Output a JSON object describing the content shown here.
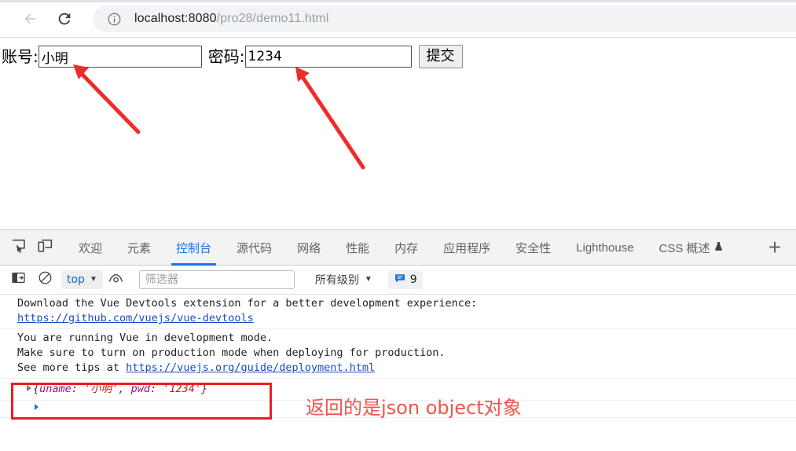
{
  "browser": {
    "back_tooltip": "Back",
    "reload_tooltip": "Reload",
    "url_host": "localhost:8080",
    "url_path": "/pro28/demo11.html",
    "url_full": "localhost:8080/pro28/demo11.html"
  },
  "page": {
    "form": {
      "uname_label": "账号:",
      "uname_value": "小明",
      "pwd_label": "密码:",
      "pwd_value": "1234",
      "submit_label": "提交"
    }
  },
  "devtools": {
    "tabs": [
      {
        "label": "欢迎",
        "active": false
      },
      {
        "label": "元素",
        "active": false
      },
      {
        "label": "控制台",
        "active": true
      },
      {
        "label": "源代码",
        "active": false
      },
      {
        "label": "网络",
        "active": false
      },
      {
        "label": "性能",
        "active": false
      },
      {
        "label": "内存",
        "active": false
      },
      {
        "label": "应用程序",
        "active": false
      },
      {
        "label": "安全性",
        "active": false
      },
      {
        "label": "Lighthouse",
        "active": false
      },
      {
        "label": "CSS 概述",
        "active": false
      }
    ],
    "add_panel_label": "+",
    "console_toolbar": {
      "context_label": "top",
      "filter_placeholder": "筛选器",
      "filter_value": "",
      "level_label": "所有级别",
      "message_count": "9"
    },
    "console_messages": [
      {
        "lines": [
          "Download the Vue Devtools extension for a better development experience:",
          "https://github.com/vuejs/vue-devtools"
        ],
        "link_line_index": 1
      },
      {
        "lines": [
          "You are running Vue in development mode.",
          "Make sure to turn on production mode when deploying for production.",
          "See more tips at https://vuejs.org/guide/deployment.html"
        ],
        "link_text": "https://vuejs.org/guide/deployment.html"
      }
    ],
    "object_output": {
      "open_brace": "{",
      "key1": "uname",
      "sep1": ": ",
      "value1": "'小明'",
      "comma": ", ",
      "key2": "pwd",
      "sep2": ": ",
      "value2": "'1234'",
      "close_brace": "}"
    }
  },
  "annotations": {
    "object_note": "返回的是json object对象",
    "arrow_color": "#ee2c28",
    "box_color": "#ee1d23",
    "note_color": "#f2544c"
  },
  "colors": {
    "accent_blue": "#1a73e8",
    "devtools_bg": "#f3f3f3",
    "console_key_purple": "#881391",
    "console_string_red": "#c41a16",
    "console_link_blue": "#1a4bc4"
  }
}
